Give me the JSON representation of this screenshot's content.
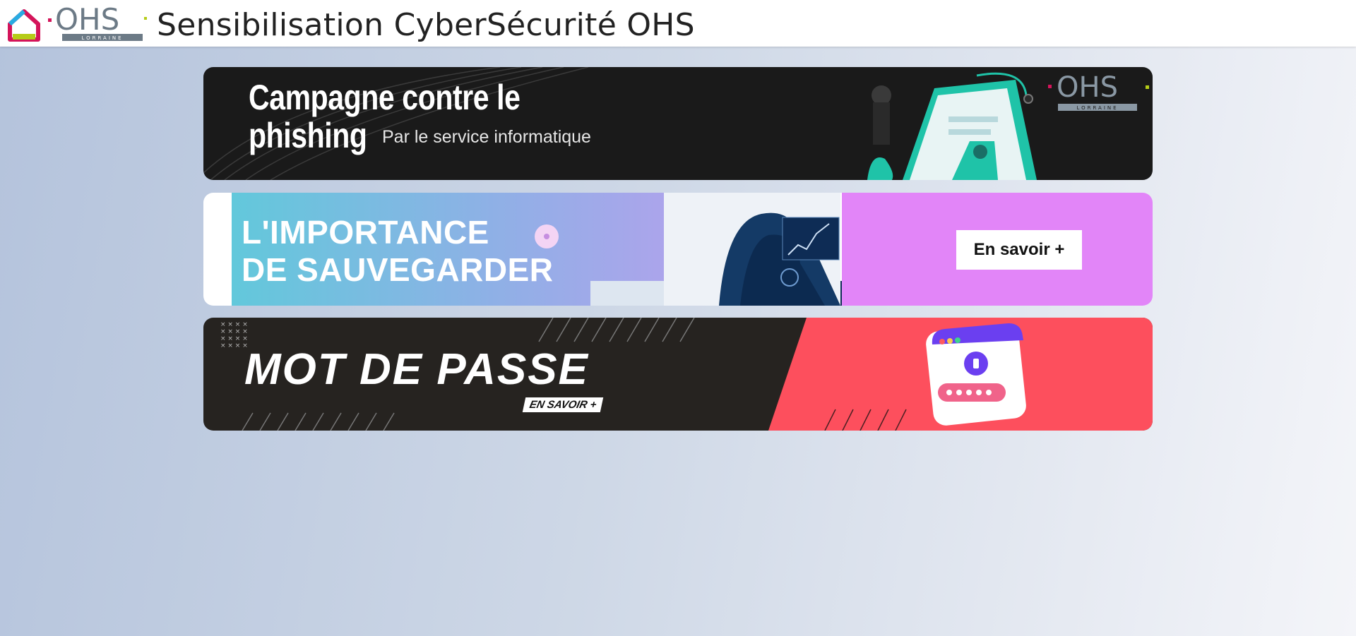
{
  "header": {
    "logo_text": "OHS",
    "logo_subtext": "LORRAINE",
    "title": "Sensibilisation CyberSécurité OHS"
  },
  "banners": [
    {
      "title_line1": "Campagne contre le",
      "title_line2": "phishing",
      "subtitle": "Par le service informatique",
      "logo_text": "OHS",
      "logo_subtext": "LORRAINE"
    },
    {
      "title_line1": "L'IMPORTANCE",
      "title_line2": "DE SAUVEGARDER",
      "button_label": "En savoir +"
    },
    {
      "title": "MOT DE PASSE",
      "tag": "EN SAVOIR +"
    }
  ],
  "colors": {
    "banner1_bg": "#1a1a1a",
    "banner2_accent": "#e285f8",
    "banner3_red": "#fd4f5d",
    "teal": "#1fc3a8"
  }
}
